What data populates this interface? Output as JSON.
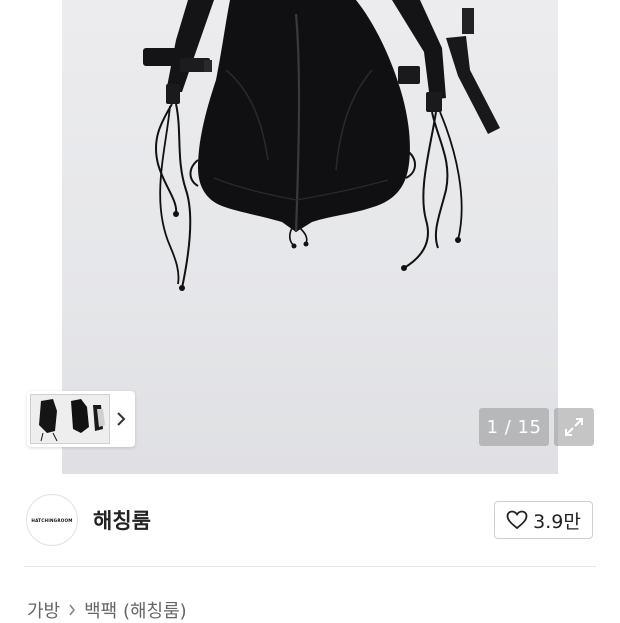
{
  "gallery": {
    "counter": "1 / 15",
    "main_image_icon": "backpack-photo",
    "thumbnail_icon": "backpack-thumbnail",
    "next_icon": "chevron-right-icon",
    "expand_icon": "expand-arrows-icon"
  },
  "shop": {
    "logo_text": "HATCHINGROOM",
    "name": "해칭룸",
    "like_icon": "heart-outline-icon",
    "like_count": "3.9만"
  },
  "breadcrumb": {
    "items": [
      "가방",
      "백팩 (해칭룸)"
    ],
    "separator_icon": "chevron-right-icon"
  },
  "colors": {
    "background": "#ffffff",
    "photo_backdrop": "#e6e7ea",
    "overlay": "#969696",
    "text_primary": "#222222",
    "text_secondary": "#666666"
  }
}
